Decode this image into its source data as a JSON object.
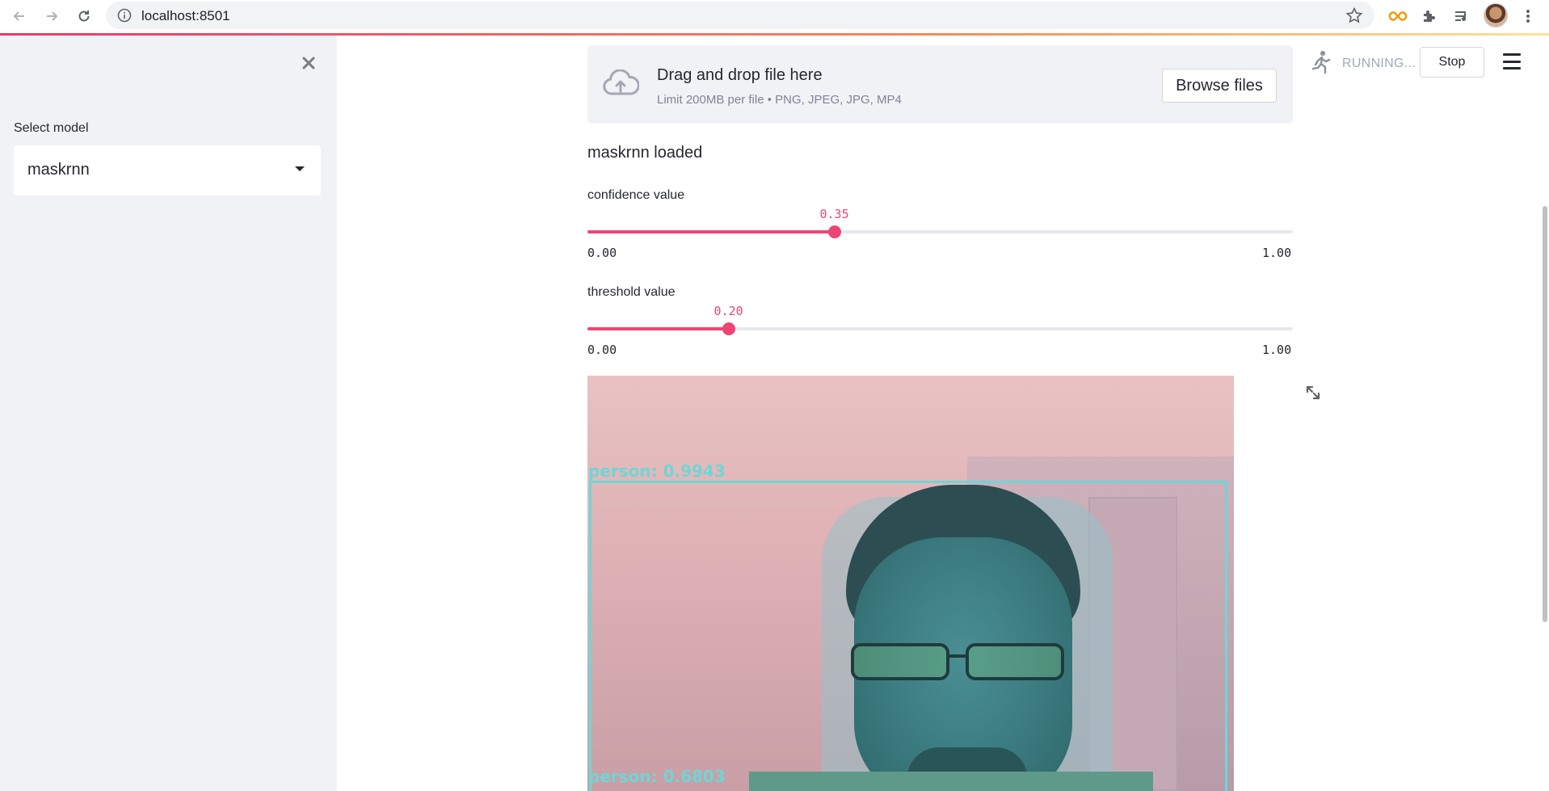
{
  "browser": {
    "url": "localhost:8501"
  },
  "sidebar": {
    "select_label": "Select model",
    "select_value": "maskrnn"
  },
  "header": {
    "status": "RUNNING...",
    "stop_label": "Stop"
  },
  "uploader": {
    "title": "Drag and drop file here",
    "limit_text": "Limit 200MB per file • PNG, JPEG, JPG, MP4",
    "browse_label": "Browse files"
  },
  "main": {
    "loaded_text": "maskrnn loaded"
  },
  "sliders": {
    "confidence": {
      "label": "confidence value",
      "value": 0.35,
      "value_text": "0.35",
      "min": "0.00",
      "max": "1.00"
    },
    "threshold": {
      "label": "threshold value",
      "value": 0.2,
      "value_text": "0.20",
      "min": "0.00",
      "max": "1.00"
    }
  },
  "detections": [
    {
      "label": "person: 0.9943"
    },
    {
      "label": "person: 0.6803"
    }
  ],
  "colors": {
    "accent": "#ee4474",
    "sidebar_bg": "#f0f2f6",
    "detection": "#6fd6d6"
  },
  "icons": {
    "back": "arrow-left-icon",
    "forward": "arrow-right-icon",
    "reload": "reload-icon",
    "close": "close-icon",
    "upload": "cloud-upload-icon",
    "running": "running-man-icon",
    "menu": "hamburger-menu-icon",
    "fullscreen": "fullscreen-icon"
  }
}
